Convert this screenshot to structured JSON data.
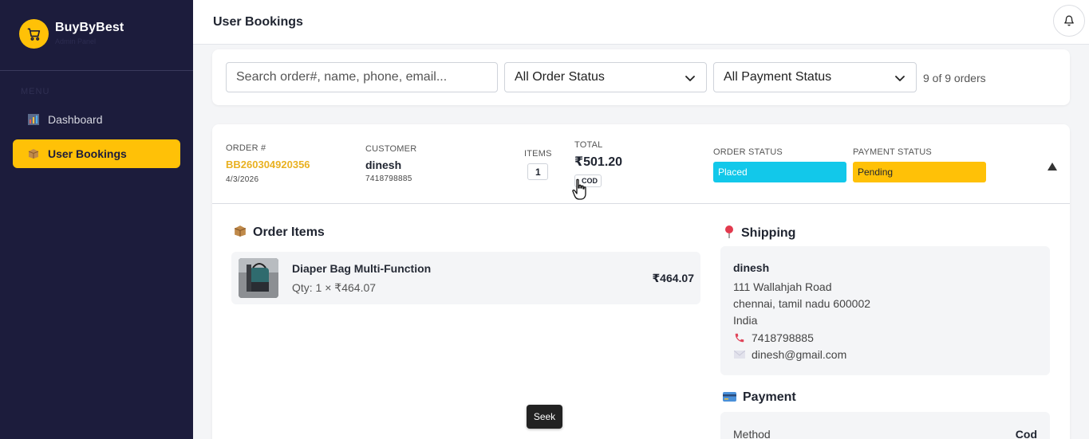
{
  "brand": {
    "name": "BuyByBest",
    "subtitle": "Admin Panel"
  },
  "sidebar": {
    "section_label": "MENU",
    "items": [
      {
        "label": "Dashboard",
        "icon": "bar-chart-icon",
        "active": false
      },
      {
        "label": "User Bookings",
        "icon": "package-icon",
        "active": true
      }
    ]
  },
  "header": {
    "title": "User Bookings"
  },
  "filters": {
    "search_placeholder": "Search order#, name, phone, email...",
    "order_status": "All Order Status",
    "payment_status": "All Payment Status",
    "count": "9 of 9 orders"
  },
  "order": {
    "labels": {
      "order_num": "ORDER #",
      "customer": "CUSTOMER",
      "items": "ITEMS",
      "total": "TOTAL",
      "order_status": "ORDER STATUS",
      "payment_status": "PAYMENT STATUS"
    },
    "number": "BB260304920356",
    "date": "4/3/2026",
    "customer_name": "dinesh",
    "customer_phone": "7418798885",
    "items_count": "1",
    "total": "₹501.20",
    "method_badge": "COD",
    "order_status": "Placed",
    "payment_status": "Pending"
  },
  "order_items": {
    "title": "Order Items",
    "items": [
      {
        "name": "Diaper Bag Multi-Function",
        "qty": "Qty: 1 × ₹464.07",
        "price": "₹464.07"
      }
    ]
  },
  "shipping": {
    "title": "Shipping",
    "name": "dinesh",
    "address1": "111 Wallahjah Road",
    "address2": "chennai, tamil nadu 600002",
    "country": "India",
    "phone": "7418798885",
    "email": "dinesh@gmail.com"
  },
  "payment": {
    "title": "Payment",
    "method_label": "Method",
    "method_value": "Cod"
  },
  "tooltip": "Seek",
  "colors": {
    "sidebar": "#1c1c3c",
    "accent": "#ffc107",
    "placed": "#12c8ea",
    "order_number": "#e9b121"
  }
}
